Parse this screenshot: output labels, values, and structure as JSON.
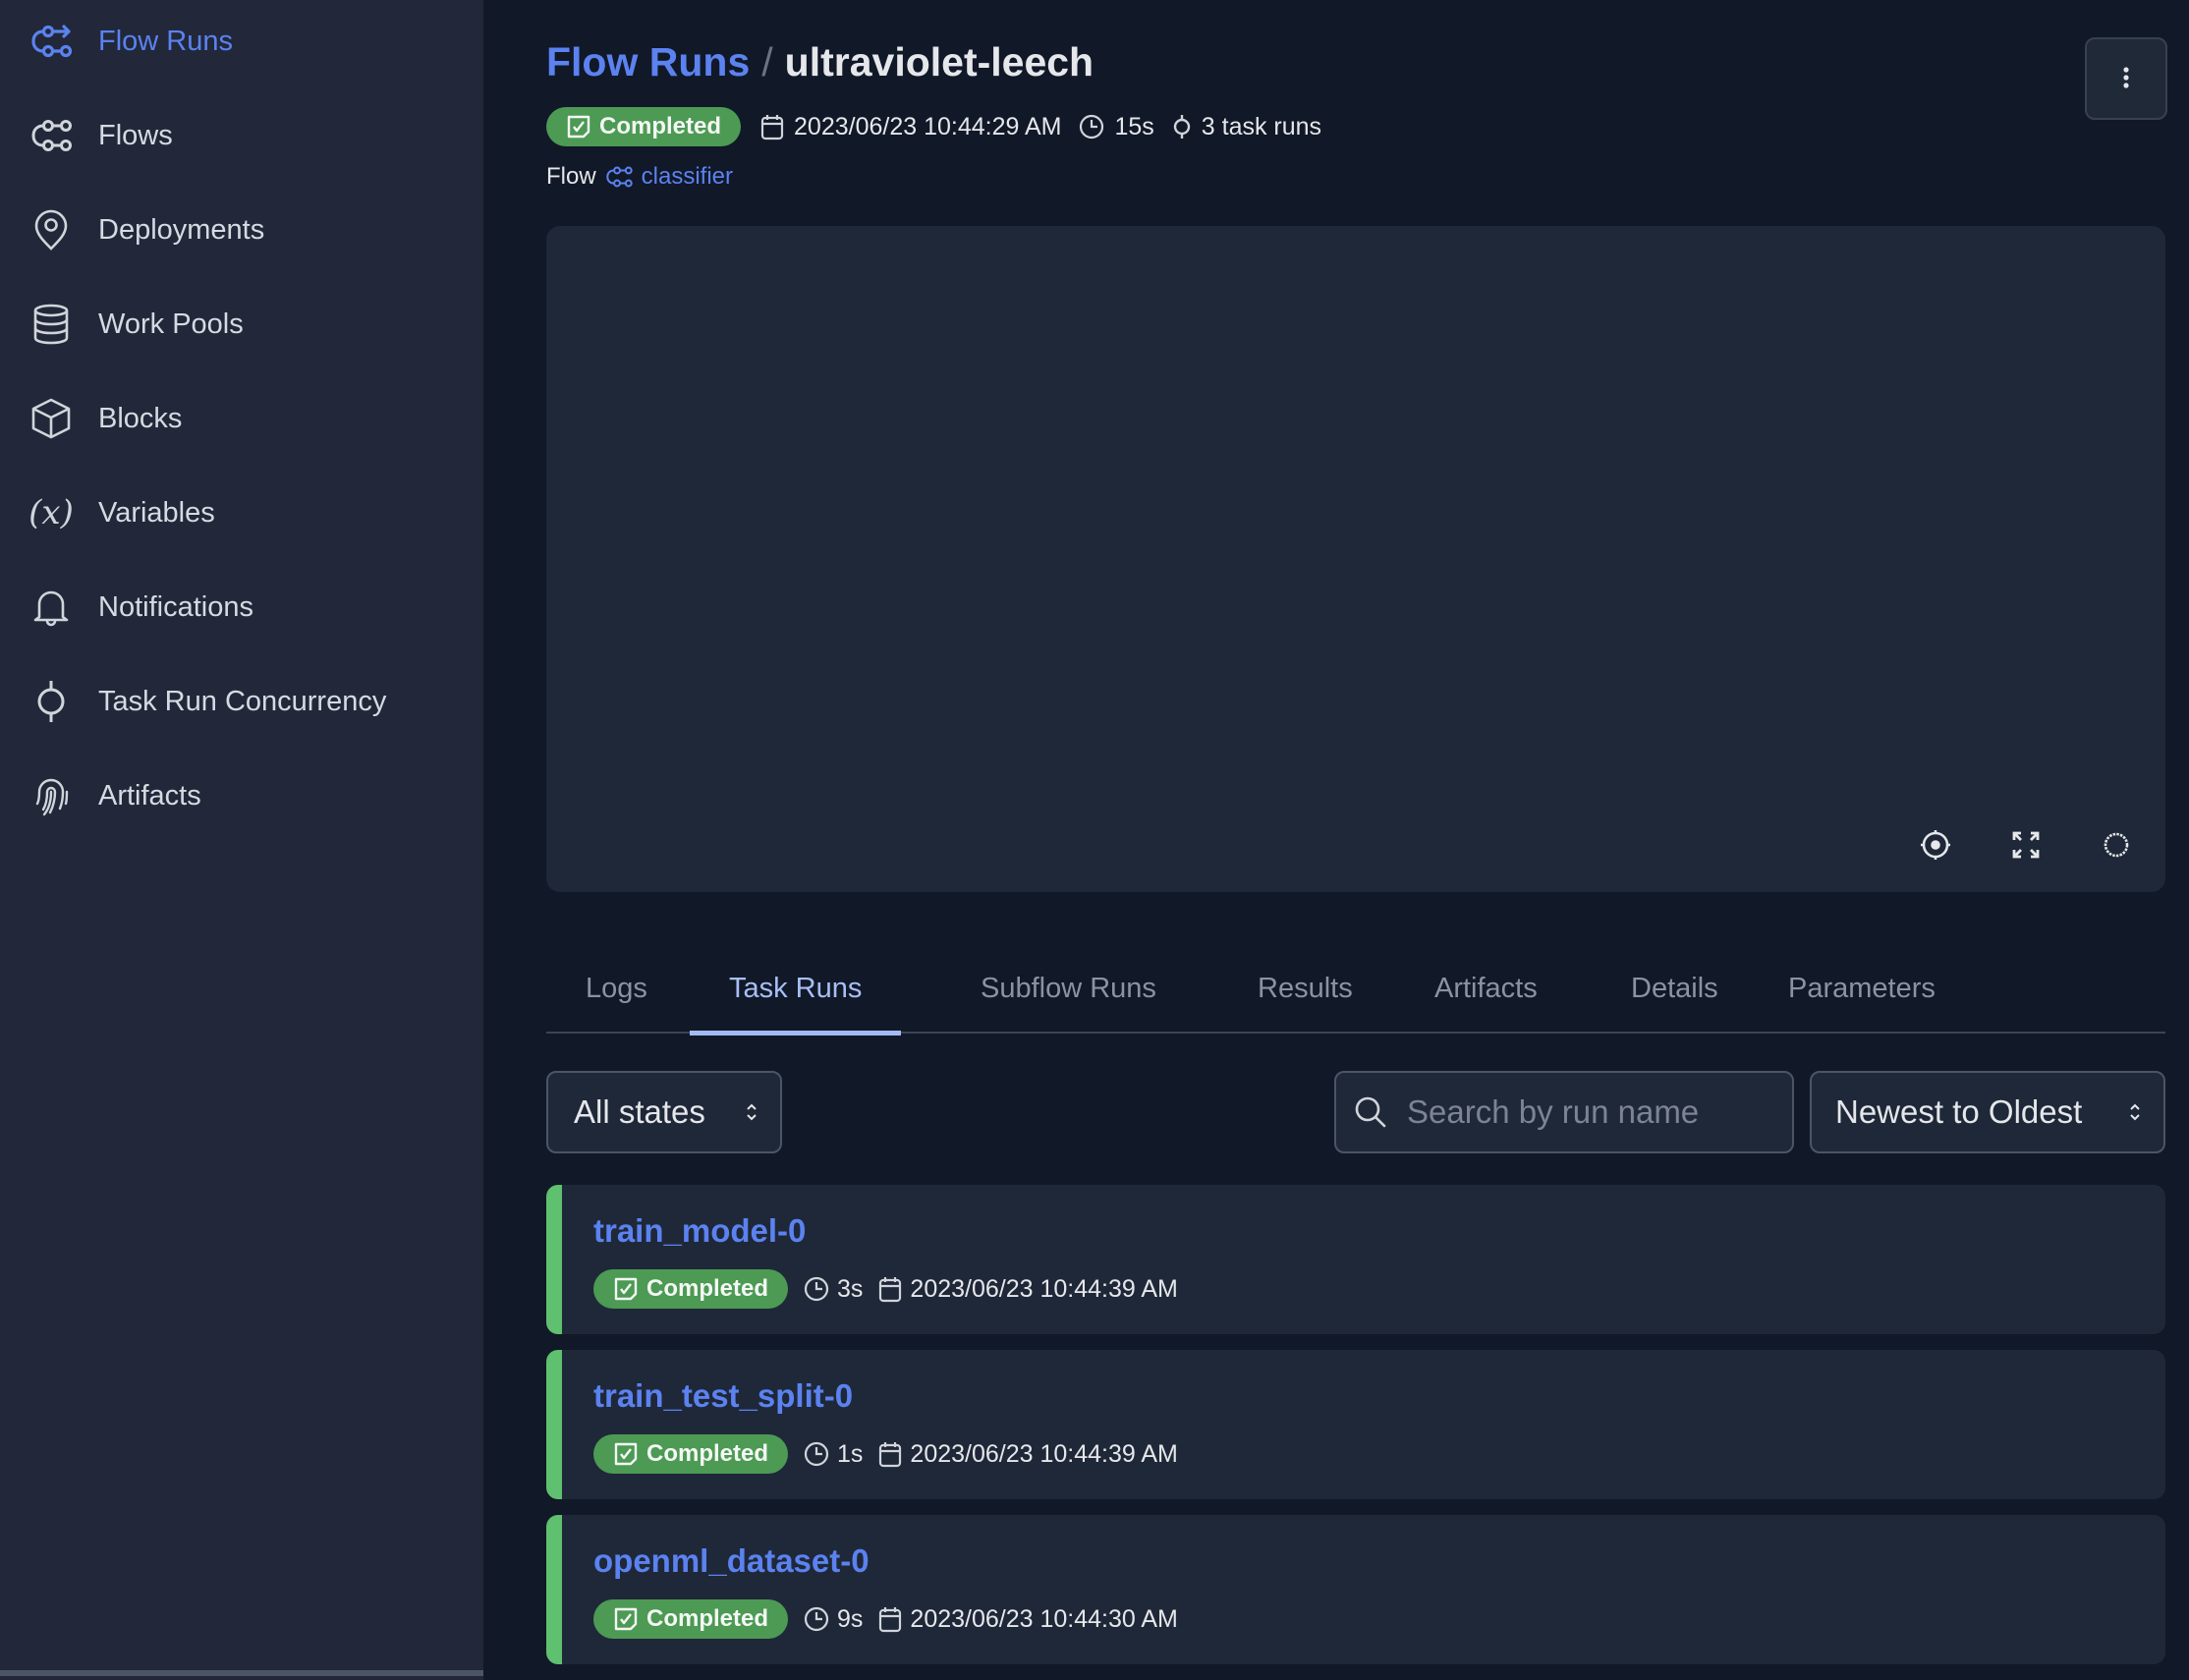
{
  "sidebar": {
    "items": [
      {
        "label": "Flow Runs",
        "icon": "flow-runs-icon",
        "active": true
      },
      {
        "label": "Flows",
        "icon": "flows-icon"
      },
      {
        "label": "Deployments",
        "icon": "map-pin-icon"
      },
      {
        "label": "Work Pools",
        "icon": "database-icon"
      },
      {
        "label": "Blocks",
        "icon": "cube-icon"
      },
      {
        "label": "Variables",
        "icon": "variable-icon"
      },
      {
        "label": "Notifications",
        "icon": "bell-icon"
      },
      {
        "label": "Task Run Concurrency",
        "icon": "commit-icon"
      },
      {
        "label": "Artifacts",
        "icon": "fingerprint-icon"
      }
    ]
  },
  "header": {
    "breadcrumb_parent": "Flow Runs",
    "breadcrumb_separator": "/",
    "title": "ultraviolet-leech",
    "menu_icon": "vertical-ellipsis-icon"
  },
  "run": {
    "state": "Completed",
    "start_time": "2023/06/23 10:44:29 AM",
    "duration": "15s",
    "task_runs": "3 task runs",
    "flow_label": "Flow",
    "flow_name": "classifier"
  },
  "graph_controls": {
    "recenter": "crosshair-icon",
    "fullscreen": "expand-icon",
    "settings": "gear-icon"
  },
  "tabs": [
    {
      "label": "Logs"
    },
    {
      "label": "Task Runs",
      "active": true
    },
    {
      "label": "Subflow Runs"
    },
    {
      "label": "Results"
    },
    {
      "label": "Artifacts"
    },
    {
      "label": "Details"
    },
    {
      "label": "Parameters"
    }
  ],
  "filters": {
    "state_select": "All states",
    "search_placeholder": "Search by run name",
    "search_value": "",
    "sort_select": "Newest to Oldest"
  },
  "task_runs": [
    {
      "name": "train_model-0",
      "state": "Completed",
      "duration": "3s",
      "start_time": "2023/06/23 10:44:39 AM"
    },
    {
      "name": "train_test_split-0",
      "state": "Completed",
      "duration": "1s",
      "start_time": "2023/06/23 10:44:39 AM"
    },
    {
      "name": "openml_dataset-0",
      "state": "Completed",
      "duration": "9s",
      "start_time": "2023/06/23 10:44:30 AM"
    }
  ],
  "colors": {
    "accent": "#5b82f0",
    "completed": "#4c9a54",
    "completed_stripe": "#5fc06f",
    "background": "#111827",
    "sidebar": "#222839",
    "surface": "#1f2838"
  }
}
